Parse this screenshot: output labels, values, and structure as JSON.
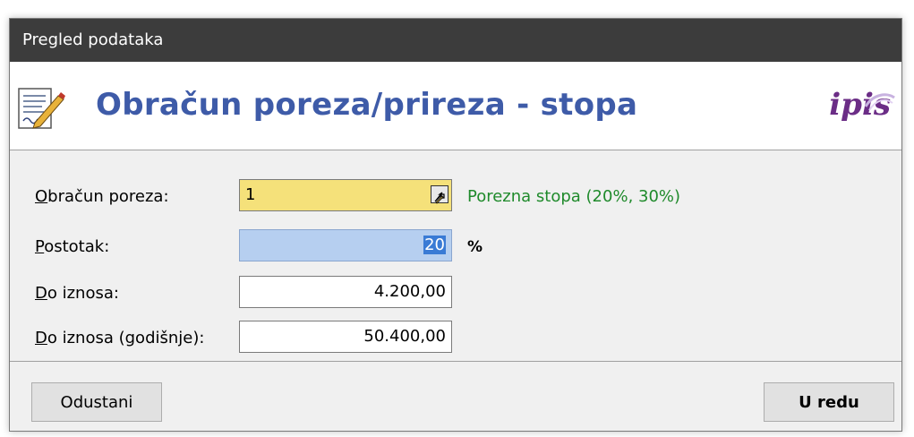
{
  "window": {
    "title": "Pregled podataka"
  },
  "header": {
    "title": "Obračun poreza/prireza - stopa",
    "logo_text": "ipis",
    "icon": "document-edit-icon"
  },
  "form": {
    "fields": [
      {
        "label": "Obračun poreza:",
        "accel": "O",
        "rest": "bračun poreza:",
        "value": "1",
        "hint": "Porezna stopa (20%, 30%)"
      },
      {
        "label": "Postotak:",
        "accel": "P",
        "rest": "ostotak:",
        "value": "20",
        "suffix": "%"
      },
      {
        "label": "Do iznosa:",
        "accel": "D",
        "rest": "o iznosa:",
        "value": "4.200,00"
      },
      {
        "label": "Do iznosa (godišnje):",
        "accel": "D",
        "rest": "o iznosa (godišnje):",
        "value": "50.400,00"
      }
    ]
  },
  "buttons": {
    "cancel": "Odustani",
    "ok": "U redu"
  },
  "colors": {
    "titlebar": "#3c3c3c",
    "header_title": "#3e5ba8",
    "hint": "#1f8a2b",
    "field_yellow": "#f5e17a",
    "field_selected": "#b6cff0",
    "logo": "#6b2d86"
  }
}
